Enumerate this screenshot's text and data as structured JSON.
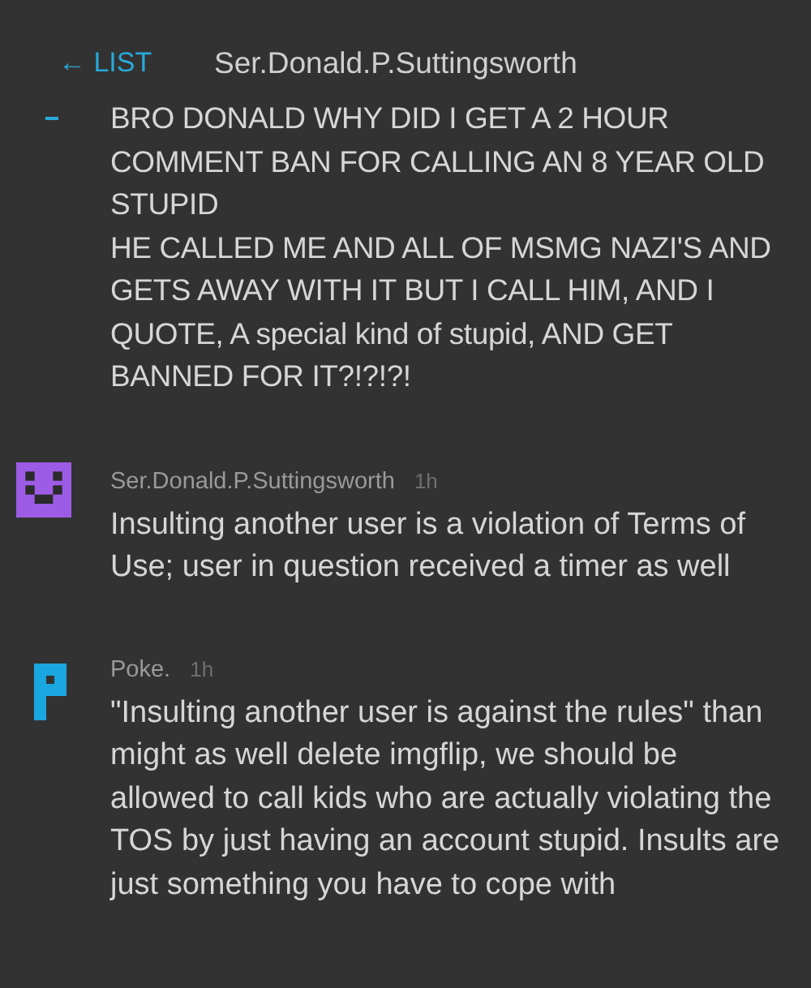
{
  "header": {
    "back_link": "← LIST",
    "title": "Ser.Donald.P.Suttingsworth"
  },
  "comments": [
    {
      "kind": "cut",
      "paragraphs": [
        "BRO DONALD WHY DID I GET A 2 HOUR COMMENT BAN FOR CALLING AN 8 YEAR OLD STUPID",
        "HE CALLED ME AND ALL OF MSMG NAZI'S AND GETS AWAY WITH IT BUT I CALL HIM, AND I QUOTE, A special kind of stupid, AND GET BANNED FOR IT?!?!?!"
      ]
    },
    {
      "kind": "full",
      "avatar": {
        "kind": "pixel-face",
        "color": "#9d5ce6"
      },
      "author": "Ser.Donald.P.Suttingsworth",
      "time": "1h",
      "paragraphs": [
        "Insulting another user is a violation of Terms of Use; user in question received a timer as well"
      ]
    },
    {
      "kind": "full",
      "avatar": {
        "kind": "pixel-block",
        "color": "#1aa7e0"
      },
      "author": "Poke.",
      "time": "1h",
      "paragraphs": [
        "\"Insulting another user is against the rules\" than might as well delete imgflip, we should be allowed to call kids who are actually violating the TOS by just having an account stupid. Insults are just something you have to cope with"
      ]
    }
  ]
}
